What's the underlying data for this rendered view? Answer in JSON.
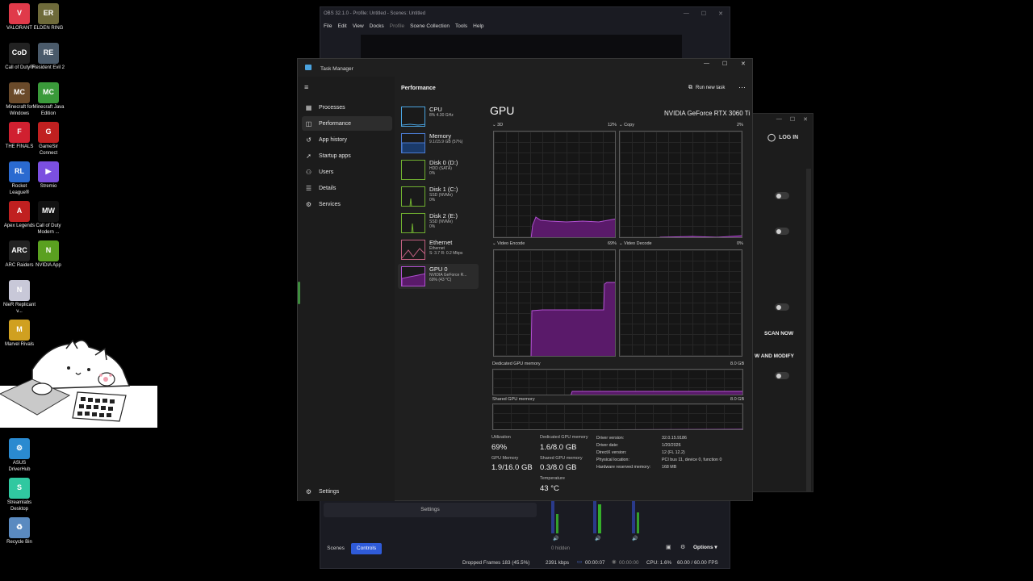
{
  "desktop": {
    "icons": [
      {
        "label": "VALORANT",
        "glyph": "V",
        "color": "#e03a4a"
      },
      {
        "label": "ELDEN RING",
        "glyph": "ER",
        "color": "#6e6a3a"
      },
      {
        "label": "Call of Duty®",
        "glyph": "CoD",
        "color": "#222"
      },
      {
        "label": "Resident Evil 2",
        "glyph": "RE",
        "color": "#4a5a6a"
      },
      {
        "label": "Minecraft for Windows",
        "glyph": "MC",
        "color": "#6a4a2a"
      },
      {
        "label": "Minecraft Java Edition",
        "glyph": "MC",
        "color": "#3a9a3a"
      },
      {
        "label": "THE FINALS",
        "glyph": "F",
        "color": "#d02030"
      },
      {
        "label": "GameSir Connect",
        "glyph": "G",
        "color": "#c02020"
      },
      {
        "label": "Rocket League®",
        "glyph": "RL",
        "color": "#2a6ad0"
      },
      {
        "label": "Stremio",
        "glyph": "▶",
        "color": "#7b4fe0"
      },
      {
        "label": "Apex Legends",
        "glyph": "A",
        "color": "#c02020"
      },
      {
        "label": "Call of Duty Modern ...",
        "glyph": "MW",
        "color": "#111"
      },
      {
        "label": "ARC Raiders",
        "glyph": "ARC",
        "color": "#222"
      },
      {
        "label": "NVIDIA App",
        "glyph": "N",
        "color": "#5aa020"
      },
      {
        "label": "NieR Replicant v...",
        "glyph": "N",
        "color": "#c8c8d8"
      },
      {
        "label": "Marvel Rivals",
        "glyph": "M",
        "color": "#d0a020"
      },
      {
        "label": "ASUS DriverHub",
        "glyph": "⚙",
        "color": "#2a8ad0"
      },
      {
        "label": "Streamlabs Desktop",
        "glyph": "S",
        "color": "#30c8a0"
      },
      {
        "label": "Recycle Bin",
        "glyph": "♻",
        "color": "#5a8ac0"
      }
    ]
  },
  "obs": {
    "title": "OBS 32.1.0 - Profile: Untitled - Scenes: Untitled",
    "menu": [
      "File",
      "Edit",
      "View",
      "Docks",
      "Profile",
      "Scene Collection",
      "Tools",
      "Help"
    ],
    "settings_label": "Settings",
    "tabs": [
      "Scenes",
      "Controls"
    ],
    "hidden_label": "0 hidden",
    "options_label": "Options",
    "status": {
      "dropped": "Dropped Frames 183 (45.5%)",
      "bitrate": "2391 kbps",
      "rec_time": "00:00:07",
      "stream_time": "00:00:00",
      "cpu": "CPU: 1.6%",
      "fps": "60.00 / 60.00 FPS"
    }
  },
  "side_app": {
    "login": "LOG IN",
    "scan_now": "SCAN NOW",
    "modify": "W AND MODIFY"
  },
  "task_manager": {
    "title": "Task Manager",
    "section_title": "Performance",
    "run_new_task": "Run new task",
    "nav": [
      {
        "label": "Processes",
        "icon": "▦"
      },
      {
        "label": "Performance",
        "icon": "◫"
      },
      {
        "label": "App history",
        "icon": "↺"
      },
      {
        "label": "Startup apps",
        "icon": "➚"
      },
      {
        "label": "Users",
        "icon": "⚇"
      },
      {
        "label": "Details",
        "icon": "☰"
      },
      {
        "label": "Services",
        "icon": "⚙"
      }
    ],
    "settings": "Settings",
    "resources": [
      {
        "name": "CPU",
        "line1": "8%  4.30 GHz",
        "line2": ""
      },
      {
        "name": "Memory",
        "line1": "9.1/15.9 GB (57%)",
        "line2": ""
      },
      {
        "name": "Disk 0 (D:)",
        "line1": "HDD (SATA)",
        "line2": "0%"
      },
      {
        "name": "Disk 1 (C:)",
        "line1": "SSD (NVMe)",
        "line2": "0%"
      },
      {
        "name": "Disk 2 (E:)",
        "line1": "SSD (NVMe)",
        "line2": "0%"
      },
      {
        "name": "Ethernet",
        "line1": "Ethernet",
        "line2": "S: 3.7  R: 0.2 Mbps"
      },
      {
        "name": "GPU 0",
        "line1": "NVIDIA GeForce R...",
        "line2": "69% (43 °C)"
      }
    ],
    "gpu": {
      "heading": "GPU",
      "model": "NVIDIA GeForce RTX 3060 Ti",
      "engines": [
        {
          "label": "3D",
          "pct": "12%"
        },
        {
          "label": "Copy",
          "pct": "2%"
        },
        {
          "label": "Video Encode",
          "pct": "69%"
        },
        {
          "label": "Video Decode",
          "pct": "0%"
        }
      ],
      "dedicated_label": "Dedicated GPU memory",
      "dedicated_max": "8.0 GB",
      "shared_label": "Shared GPU memory",
      "shared_max": "8.0 GB",
      "stats": {
        "utilization_label": "Utilization",
        "utilization": "69%",
        "ded_mem_label": "Dedicated GPU memory",
        "ded_mem": "1.6/8.0 GB",
        "gpu_mem_label": "GPU Memory",
        "gpu_mem": "1.9/16.0 GB",
        "shared_mem_label": "Shared GPU memory",
        "shared_mem": "0.3/8.0 GB",
        "temp_label": "Temperature",
        "temp": "43 °C"
      },
      "info": [
        {
          "k": "Driver version:",
          "v": "32.0.15.9186"
        },
        {
          "k": "Driver date:",
          "v": "1/20/2026"
        },
        {
          "k": "DirectX version:",
          "v": "12 (FL 12.2)"
        },
        {
          "k": "Physical location:",
          "v": "PCI bus 11, device 0, function 0"
        },
        {
          "k": "Hardware reserved memory:",
          "v": "168 MB"
        }
      ]
    },
    "colors": {
      "gpu": "#a040c0",
      "accent": "#3e8e3e"
    }
  }
}
